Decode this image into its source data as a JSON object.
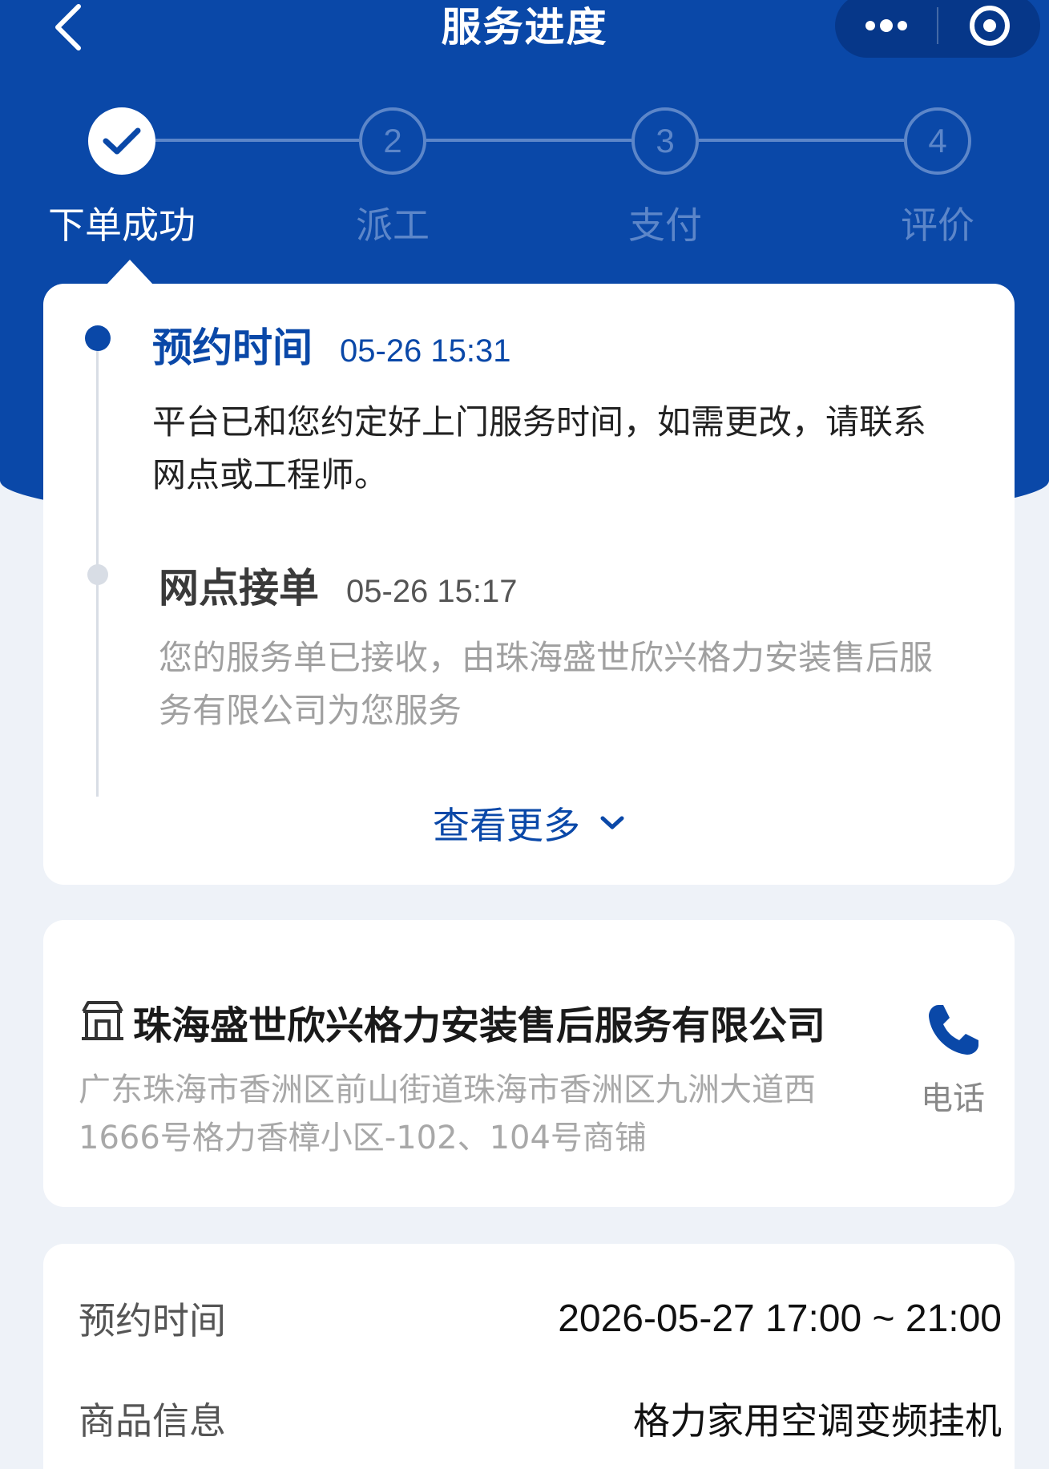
{
  "nav": {
    "title": "服务进度",
    "back_icon": "chevron-left-icon",
    "more_icon": "more-dots-icon",
    "close_icon": "target-circle-icon"
  },
  "steps": [
    {
      "number": "",
      "label": "下单成功",
      "status": "done"
    },
    {
      "number": "2",
      "label": "派工",
      "status": "pending"
    },
    {
      "number": "3",
      "label": "支付",
      "status": "pending"
    },
    {
      "number": "4",
      "label": "评价",
      "status": "pending"
    }
  ],
  "timeline": {
    "items": [
      {
        "title": "预约时间",
        "time": "05-26 15:31",
        "desc": "平台已和您约定好上门服务时间，如需更改，请联系网点或工程师。",
        "status": "active"
      },
      {
        "title": "网点接单",
        "time": "05-26 15:17",
        "desc": "您的服务单已接收，由珠海盛世欣兴格力安装售后服务有限公司为您服务",
        "status": "past"
      }
    ],
    "more_label": "查看更多"
  },
  "shop": {
    "name": "珠海盛世欣兴格力安装售后服务有限公司",
    "address": "广东珠海市香洲区前山街道珠海市香洲区九洲大道西1666号格力香樟小区-102、104号商铺",
    "phone_label": "电话"
  },
  "info": {
    "rows": [
      {
        "label": "预约时间",
        "value": "2026-05-27 17:00 ~ 21:00"
      },
      {
        "label": "商品信息",
        "value": "格力家用空调变频挂机"
      }
    ]
  },
  "colors": {
    "brand": "#0a48a8",
    "inactive_step": "#5c86c9",
    "background": "#eef2f8"
  }
}
